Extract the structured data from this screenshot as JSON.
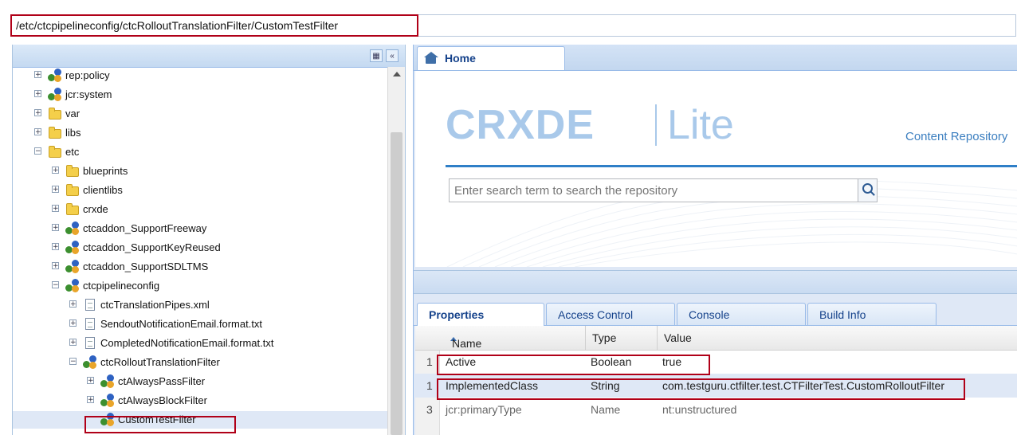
{
  "path_bar": {
    "value": "/etc/ctcpipelineconfig/ctcRolloutTranslationFilter/CustomTestFilter"
  },
  "tree": {
    "items": [
      {
        "label": "rep:policy",
        "icon": "node-icon",
        "level": 1,
        "expander": "+"
      },
      {
        "label": "jcr:system",
        "icon": "node-icon",
        "level": 1,
        "expander": "+"
      },
      {
        "label": "var",
        "icon": "folder-icon",
        "level": 1,
        "expander": "+"
      },
      {
        "label": "libs",
        "icon": "folder-icon",
        "level": 1,
        "expander": "+"
      },
      {
        "label": "etc",
        "icon": "folder-icon",
        "level": 1,
        "expander": "−"
      },
      {
        "label": "blueprints",
        "icon": "folder-icon",
        "level": 2,
        "expander": "+"
      },
      {
        "label": "clientlibs",
        "icon": "folder-icon",
        "level": 2,
        "expander": "+"
      },
      {
        "label": "crxde",
        "icon": "folder-icon",
        "level": 2,
        "expander": "+"
      },
      {
        "label": "ctcaddon_SupportFreeway",
        "icon": "node-icon",
        "level": 2,
        "expander": "+"
      },
      {
        "label": "ctcaddon_SupportKeyReused",
        "icon": "node-icon",
        "level": 2,
        "expander": "+"
      },
      {
        "label": "ctcaddon_SupportSDLTMS",
        "icon": "node-icon",
        "level": 2,
        "expander": "+"
      },
      {
        "label": "ctcpipelineconfig",
        "icon": "node-icon",
        "level": 2,
        "expander": "−"
      },
      {
        "label": "ctcTranslationPipes.xml",
        "icon": "file-icon",
        "level": 3,
        "expander": "+"
      },
      {
        "label": "SendoutNotificationEmail.format.txt",
        "icon": "file-icon",
        "level": 3,
        "expander": "+"
      },
      {
        "label": "CompletedNotificationEmail.format.txt",
        "icon": "file-icon",
        "level": 3,
        "expander": "+"
      },
      {
        "label": "ctcRolloutTranslationFilter",
        "icon": "node-icon",
        "level": 3,
        "expander": "−"
      },
      {
        "label": "ctAlwaysPassFilter",
        "icon": "node-icon",
        "level": 4,
        "expander": "+"
      },
      {
        "label": "ctAlwaysBlockFilter",
        "icon": "node-icon",
        "level": 4,
        "expander": "+"
      },
      {
        "label": "CustomTestFilter",
        "icon": "node-icon",
        "level": 4,
        "expander": "",
        "selected": true
      }
    ]
  },
  "home_tab": {
    "label": "Home"
  },
  "home": {
    "logo_main": "CRXDE",
    "logo_lite": "Lite",
    "tagline": "Content Repository",
    "search_placeholder": "Enter search term to search the repository"
  },
  "bottom_tabs": [
    {
      "label": "Properties",
      "active": true
    },
    {
      "label": "Access Control",
      "active": false
    },
    {
      "label": "Console",
      "active": false
    },
    {
      "label": "Build Info",
      "active": false
    }
  ],
  "properties": {
    "columns": [
      "Name",
      "Type",
      "Value"
    ],
    "rows": [
      {
        "num": "1",
        "name": "Active",
        "type": "Boolean",
        "value": "true",
        "selected": false
      },
      {
        "num": "1",
        "name": "ImplementedClass",
        "type": "String",
        "value": "com.testguru.ctfilter.test.CTFilterTest.CustomRolloutFilter",
        "selected": true
      },
      {
        "num": "3",
        "name": "jcr:primaryType",
        "type": "Name",
        "value": "nt:unstructured",
        "selected": false
      }
    ]
  },
  "colors": {
    "highlight": "#b00018",
    "accent": "#15428b",
    "logo": "#a9c9ea"
  }
}
